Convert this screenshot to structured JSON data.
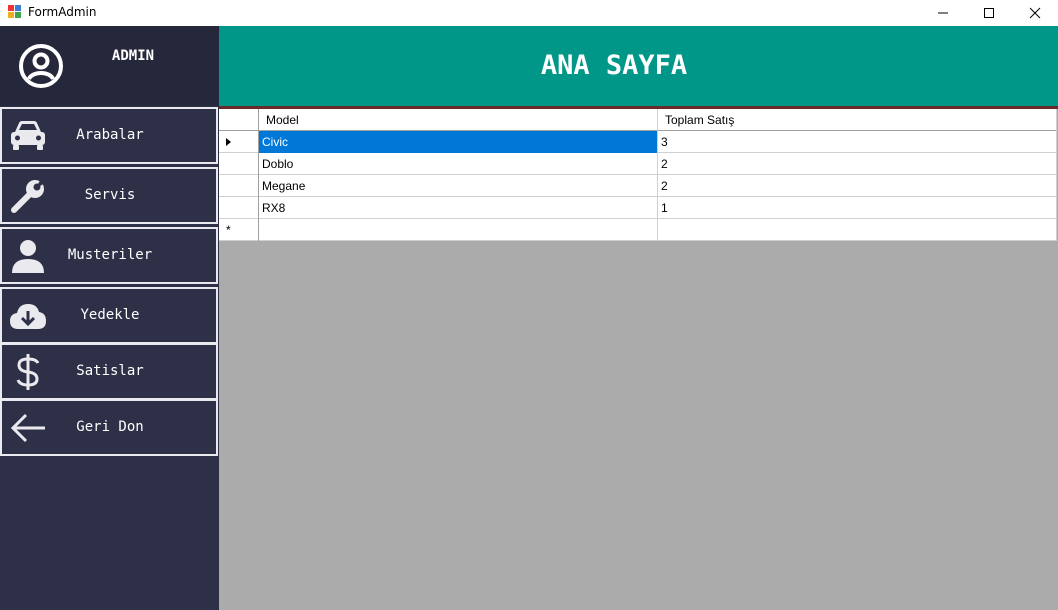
{
  "window": {
    "title": "FormAdmin",
    "controls": {
      "minimize": "minimize-icon",
      "maximize": "maximize-icon",
      "close": "close-icon"
    }
  },
  "sidebar": {
    "user": {
      "icon": "user-circle-icon",
      "label": "ADMIN"
    },
    "items": [
      {
        "label": "Arabalar",
        "icon": "car-icon"
      },
      {
        "label": "Servis",
        "icon": "wrench-icon"
      },
      {
        "label": "Musteriler",
        "icon": "person-icon"
      },
      {
        "label": "Yedekle",
        "icon": "cloud-download-icon"
      },
      {
        "label": "Satislar",
        "icon": "dollar-icon"
      },
      {
        "label": "Geri Don",
        "icon": "arrow-left-icon"
      }
    ]
  },
  "header": {
    "title": "ANA SAYFA"
  },
  "grid": {
    "columns": [
      "Model",
      "Toplam Satış"
    ],
    "rows": [
      {
        "model": "Civic",
        "total": "3"
      },
      {
        "model": "Doblo",
        "total": "2"
      },
      {
        "model": "Megane",
        "total": "2"
      },
      {
        "model": "RX8",
        "total": "1"
      }
    ],
    "new_row_marker": "*"
  },
  "colors": {
    "sidebar": "#2e3047",
    "sidebar_header": "#25273a",
    "header": "#009688",
    "grid_background": "#ababab",
    "selection": "#0078d7"
  }
}
